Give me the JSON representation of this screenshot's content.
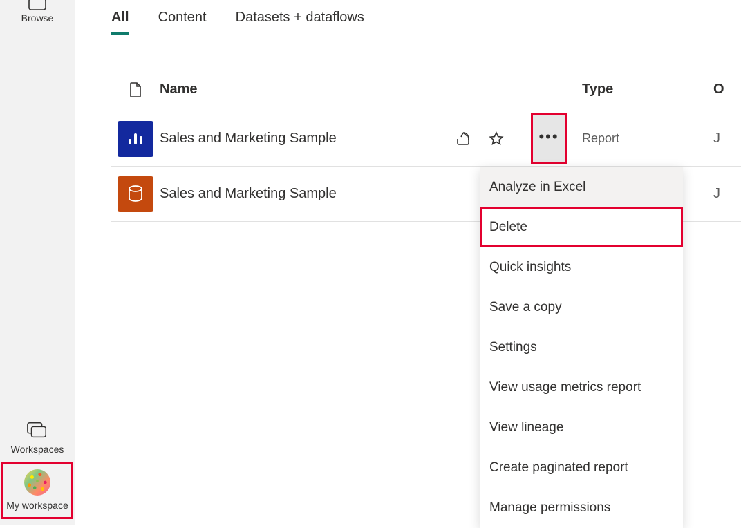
{
  "sidebar": {
    "browse_label": "Browse",
    "workspaces_label": "Workspaces",
    "my_workspace_label": "My workspace"
  },
  "tabs": [
    {
      "label": "All",
      "active": true
    },
    {
      "label": "Content",
      "active": false
    },
    {
      "label": "Datasets + dataflows",
      "active": false
    }
  ],
  "table": {
    "headers": {
      "name": "Name",
      "type": "Type",
      "end": "O"
    },
    "rows": [
      {
        "name": "Sales and Marketing Sample",
        "type": "Report",
        "end": "J",
        "icon": "report",
        "show_actions": true
      },
      {
        "name": "Sales and Marketing Sample",
        "type": "",
        "end": "J",
        "icon": "dataset",
        "show_actions": false
      }
    ]
  },
  "context_menu": {
    "items": [
      {
        "label": "Analyze in Excel",
        "hover": true,
        "highlighted": false
      },
      {
        "label": "Delete",
        "hover": false,
        "highlighted": true
      },
      {
        "label": "Quick insights",
        "hover": false,
        "highlighted": false
      },
      {
        "label": "Save a copy",
        "hover": false,
        "highlighted": false
      },
      {
        "label": "Settings",
        "hover": false,
        "highlighted": false
      },
      {
        "label": "View usage metrics report",
        "hover": false,
        "highlighted": false
      },
      {
        "label": "View lineage",
        "hover": false,
        "highlighted": false
      },
      {
        "label": "Create paginated report",
        "hover": false,
        "highlighted": false
      },
      {
        "label": "Manage permissions",
        "hover": false,
        "highlighted": false
      }
    ]
  }
}
